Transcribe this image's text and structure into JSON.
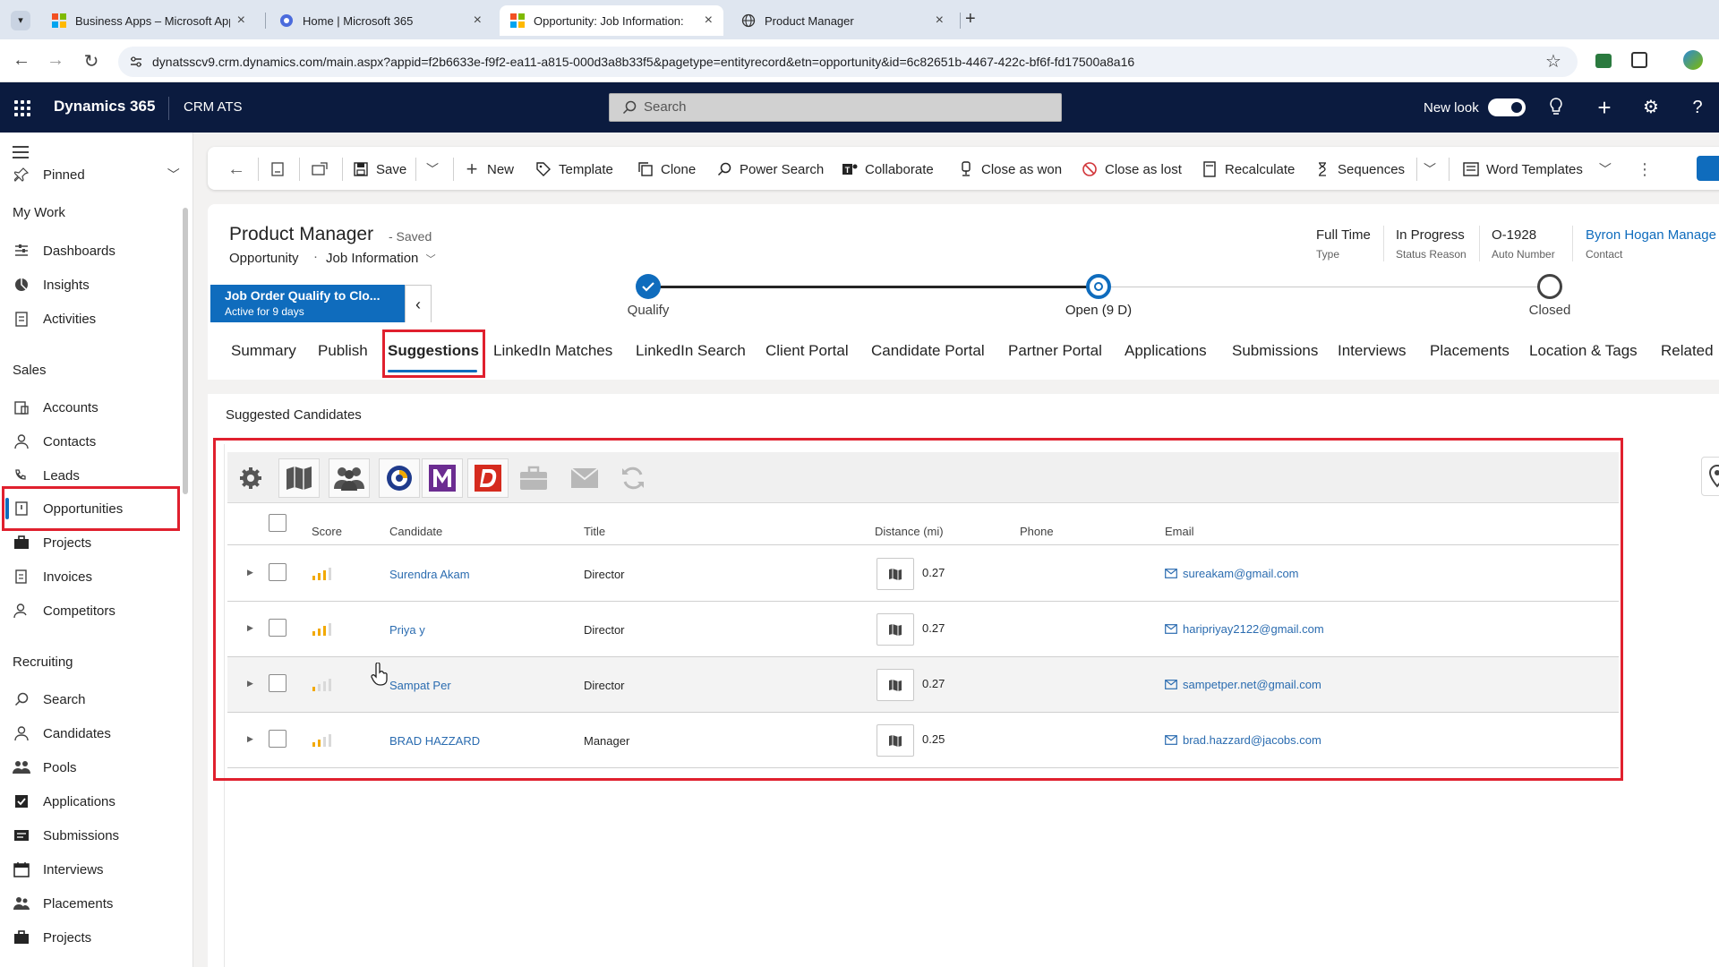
{
  "browser": {
    "tabs": [
      {
        "label": "Business Apps – Microsoft App",
        "active": false
      },
      {
        "label": "Home | Microsoft 365",
        "active": false
      },
      {
        "label": "Opportunity: Job Information:",
        "active": true
      },
      {
        "label": "Product Manager",
        "active": false
      }
    ],
    "url": "dynatsscv9.crm.dynamics.com/main.aspx?appid=f2b6633e-f9f2-ea11-a815-000d3a8b33f5&pagetype=entityrecord&etn=opportunity&id=6c82651b-4467-422c-bf6f-fd17500a8a16"
  },
  "header": {
    "brand": "Dynamics 365",
    "app_name": "CRM ATS",
    "search_placeholder": "Search",
    "new_look_label": "New look"
  },
  "nav": {
    "pinned_label": "Pinned",
    "groups": [
      {
        "label": "My Work",
        "items": [
          "Dashboards",
          "Insights",
          "Activities"
        ]
      },
      {
        "label": "Sales",
        "items": [
          "Accounts",
          "Contacts",
          "Leads",
          "Opportunities",
          "Projects",
          "Invoices",
          "Competitors"
        ]
      },
      {
        "label": "Recruiting",
        "items": [
          "Search",
          "Candidates",
          "Pools",
          "Applications",
          "Submissions",
          "Interviews",
          "Placements",
          "Projects"
        ]
      }
    ],
    "selected": "Opportunities"
  },
  "commands": {
    "save": "Save",
    "new": "New",
    "template": "Template",
    "clone": "Clone",
    "power_search": "Power Search",
    "collaborate": "Collaborate",
    "close_won": "Close as won",
    "close_lost": "Close as lost",
    "recalculate": "Recalculate",
    "sequences": "Sequences",
    "word_templates": "Word Templates"
  },
  "record": {
    "title": "Product Manager",
    "saved": "- Saved",
    "entity": "Opportunity",
    "form": "Job Information",
    "fields": [
      {
        "value": "Full Time",
        "label": "Type"
      },
      {
        "value": "In Progress",
        "label": "Status Reason"
      },
      {
        "value": "O-1928",
        "label": "Auto Number"
      },
      {
        "value": "Byron Hogan Manage",
        "label": "Contact"
      }
    ]
  },
  "bpf": {
    "stage_title": "Job Order Qualify to Clo...",
    "stage_sub": "Active for 9 days",
    "stages": [
      "Qualify",
      "Open  (9 D)",
      "Closed"
    ]
  },
  "tabs": [
    "Summary",
    "Publish",
    "Suggestions",
    "LinkedIn Matches",
    "LinkedIn Search",
    "Client Portal",
    "Candidate Portal",
    "Partner Portal",
    "Applications",
    "Submissions",
    "Interviews",
    "Placements",
    "Location & Tags",
    "Related"
  ],
  "section": {
    "title": "Suggested Candidates"
  },
  "grid": {
    "columns": {
      "score": "Score",
      "candidate": "Candidate",
      "title": "Title",
      "distance": "Distance (mi)",
      "phone": "Phone",
      "email": "Email"
    },
    "rows": [
      {
        "score": 3,
        "candidate": "Surendra Akam",
        "title": "Director",
        "distance": "0.27",
        "phone": "",
        "email": "sureakam@gmail.com"
      },
      {
        "score": 3,
        "candidate": "Priya y",
        "title": "Director",
        "distance": "0.27",
        "phone": "",
        "email": "haripriyay2122@gmail.com"
      },
      {
        "score": 1,
        "candidate": "Sampat Per",
        "title": "Director",
        "distance": "0.27",
        "phone": "",
        "email": "sampetper.net@gmail.com"
      },
      {
        "score": 2,
        "candidate": "BRAD HAZZARD",
        "title": "Manager",
        "distance": "0.25",
        "phone": "",
        "email": "brad.hazzard@jacobs.com"
      }
    ]
  },
  "colors": {
    "header_bg": "#0b1b3f",
    "accent": "#0f6cbd",
    "highlight": "#e0202e",
    "score_on": "#f2a900",
    "score_off": "#d9d9d9"
  }
}
